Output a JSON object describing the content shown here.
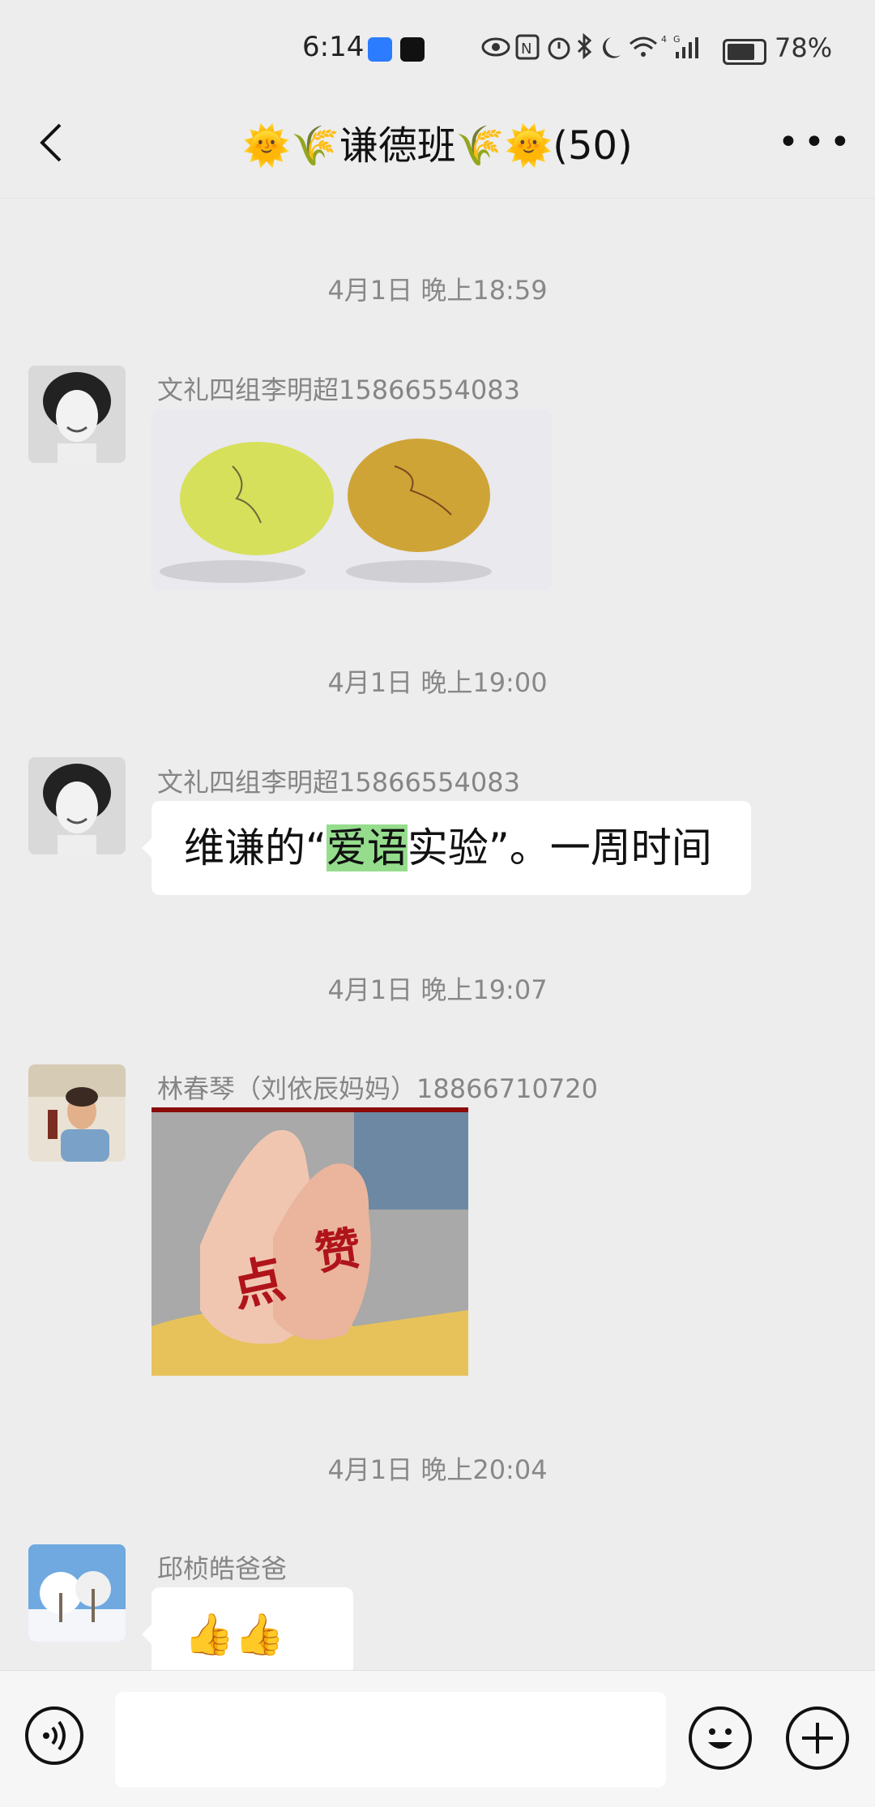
{
  "status_bar": {
    "time": "6:14",
    "icons": [
      "eye-icon",
      "nfc-icon",
      "alarm-icon",
      "bluetooth-icon",
      "moon-icon",
      "wifi-icon",
      "4g-signal-icon"
    ],
    "battery_level": 0.78,
    "battery_percent": "78%"
  },
  "header": {
    "title": "🌞🌾谦德班🌾🌞(50)",
    "back_icon": "chevron-left-icon",
    "more_icon": "ellipsis-icon"
  },
  "messages": [
    {
      "timestamp": "4月1日 晚上18:59",
      "sender": "文礼四组李明超15866554083",
      "type": "image",
      "image_subject": "two lemons with writing"
    },
    {
      "timestamp": "4月1日 晚上19:00",
      "sender": "文礼四组李明超15866554083",
      "type": "text",
      "text_before": "维谦的“",
      "text_highlight": "爱语",
      "text_after": "实验”。一周时间"
    },
    {
      "timestamp": "4月1日 晚上19:07",
      "sender": "林春琴（刘依辰妈妈）18866710720",
      "type": "image",
      "image_subject": "thumbs up sticker",
      "sticker_text_1": "点",
      "sticker_text_2": "赞"
    },
    {
      "timestamp": "4月1日 晚上20:04",
      "sender": "邱桢皓爸爸",
      "type": "text",
      "text": "👍👍👍"
    }
  ],
  "input_bar": {
    "placeholder": "",
    "voice_icon": "voice-icon",
    "emoji_icon": "smiley-icon",
    "plus_icon": "plus-icon"
  },
  "colors": {
    "background": "#ededed",
    "bubble": "#ffffff",
    "highlight": "#95dd8d",
    "timestamp": "#888888",
    "sticker_text": "#b0141b"
  }
}
